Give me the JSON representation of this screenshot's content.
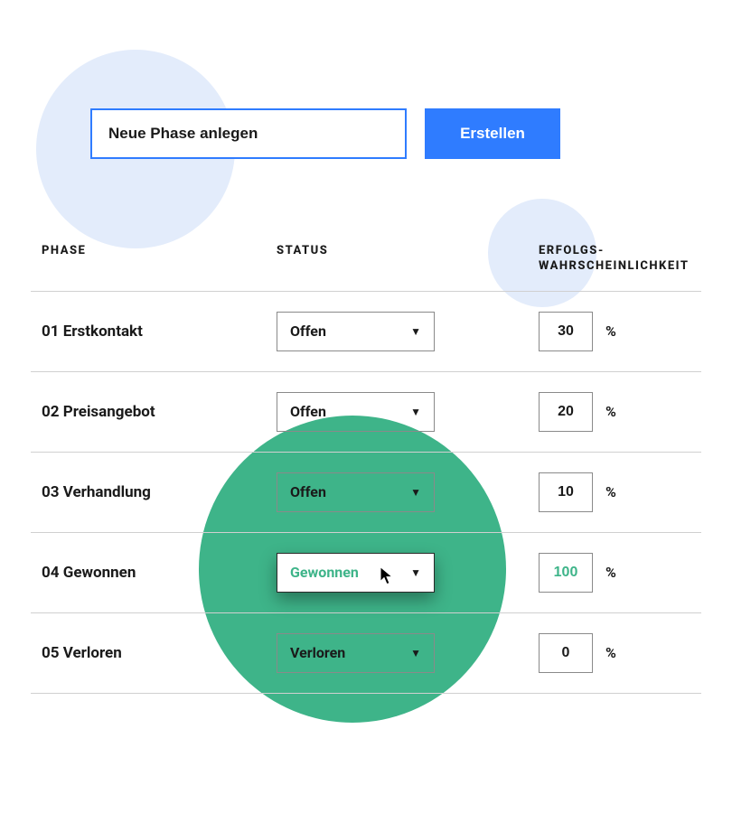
{
  "input": {
    "value": "Neue Phase anlegen",
    "create_label": "Erstellen"
  },
  "headers": {
    "phase": "PHASE",
    "status": "STATUS",
    "probability_line1": "ERFOLGS-",
    "probability_line2": "WAHRSCHEINLICHKEIT"
  },
  "percent_symbol": "%",
  "rows": [
    {
      "phase": "01 Erstkontakt",
      "status": "Offen",
      "probability": "30",
      "highlight": false
    },
    {
      "phase": "02 Preisangebot",
      "status": "Offen",
      "probability": "20",
      "highlight": false
    },
    {
      "phase": "03 Verhandlung",
      "status": "Offen",
      "probability": "10",
      "highlight": false
    },
    {
      "phase": "04 Gewonnen",
      "status": "Gewonnen",
      "probability": "100",
      "highlight": true
    },
    {
      "phase": "05 Verloren",
      "status": "Verloren",
      "probability": "0",
      "highlight": false
    }
  ],
  "colors": {
    "accent_blue": "#2f7cff",
    "accent_green": "#3eb489",
    "pale_blue": "#e3ecfb"
  }
}
